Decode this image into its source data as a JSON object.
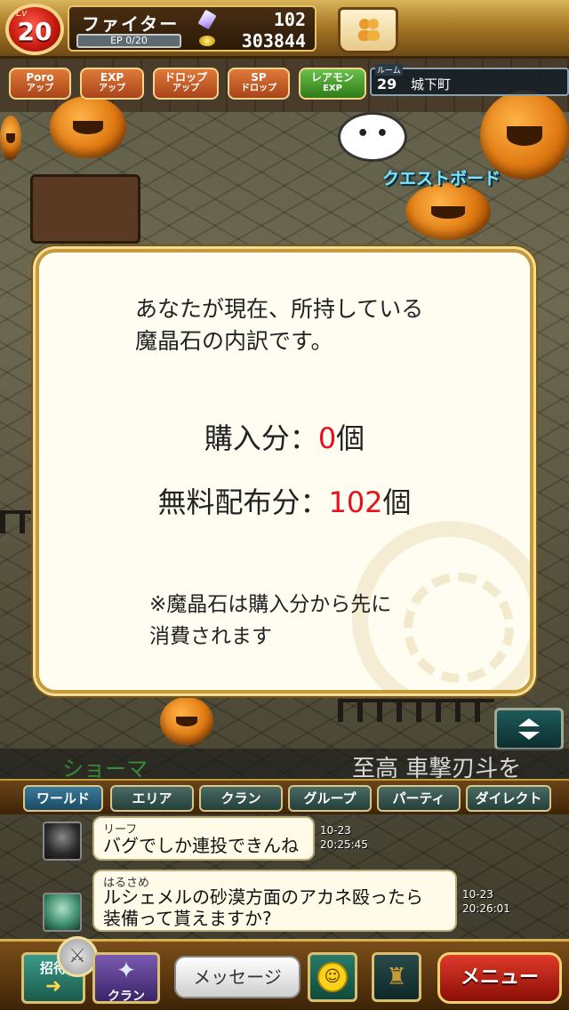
{
  "hud": {
    "level_prefix": "Lv",
    "level": "20",
    "player_name": "ファイター",
    "ep_label": "EP",
    "ep_value": "0/20",
    "gems": "102",
    "gold": "303844"
  },
  "boosts": [
    {
      "line1": "Poro",
      "line2": "アップ"
    },
    {
      "line1": "EXP",
      "line2": "アップ"
    },
    {
      "line1": "ドロップ",
      "line2": "アップ"
    },
    {
      "line1": "SP",
      "line2": "ドロップ"
    },
    {
      "line1": "レアモン",
      "line2": "EXP"
    }
  ],
  "room": {
    "label": "ルーム",
    "number": "29",
    "name": "城下町"
  },
  "world": {
    "speech_bubble": "• •",
    "quest_board": "クエストボード"
  },
  "dialog": {
    "intro_line1": "あなたが現在、所持している",
    "intro_line2": "魔晶石の内訳です。",
    "purchased_label": "購入分：",
    "purchased_value": "0",
    "purchased_unit": "個",
    "free_label": "無料配布分：",
    "free_value": "102",
    "free_unit": "個",
    "note_line1": "※魔晶石は購入分から先に",
    "note_line2": "消費されます"
  },
  "ticker": {
    "name": "ショーマ",
    "message": "至高 車撃刃斗を"
  },
  "chat_tabs": [
    "ワールド",
    "エリア",
    "クラン",
    "グループ",
    "パーティ",
    "ダイレクト"
  ],
  "chat": [
    {
      "name": "リーフ",
      "message": "バグでしか連投できんね",
      "date": "10-23",
      "time": "20:25:45"
    },
    {
      "name": "はるさめ",
      "message_line1": "ルシェメルの砂漠方面のアカネ殴ったら",
      "message_line2": "装備って貰えますか?",
      "date": "10-23",
      "time": "20:26:01"
    }
  ],
  "bottom": {
    "invite": "招待",
    "clan": "クラン",
    "message": "メッセージ",
    "menu": "メニュー"
  },
  "icons": {
    "scroll_toggle": "up-down-arrow-icon",
    "smile": "smiley-icon",
    "stamp": "stamp-icon",
    "sword": "sword-icon"
  },
  "colors": {
    "accent_red": "#e8101c",
    "gold_border": "#c49a3a"
  }
}
